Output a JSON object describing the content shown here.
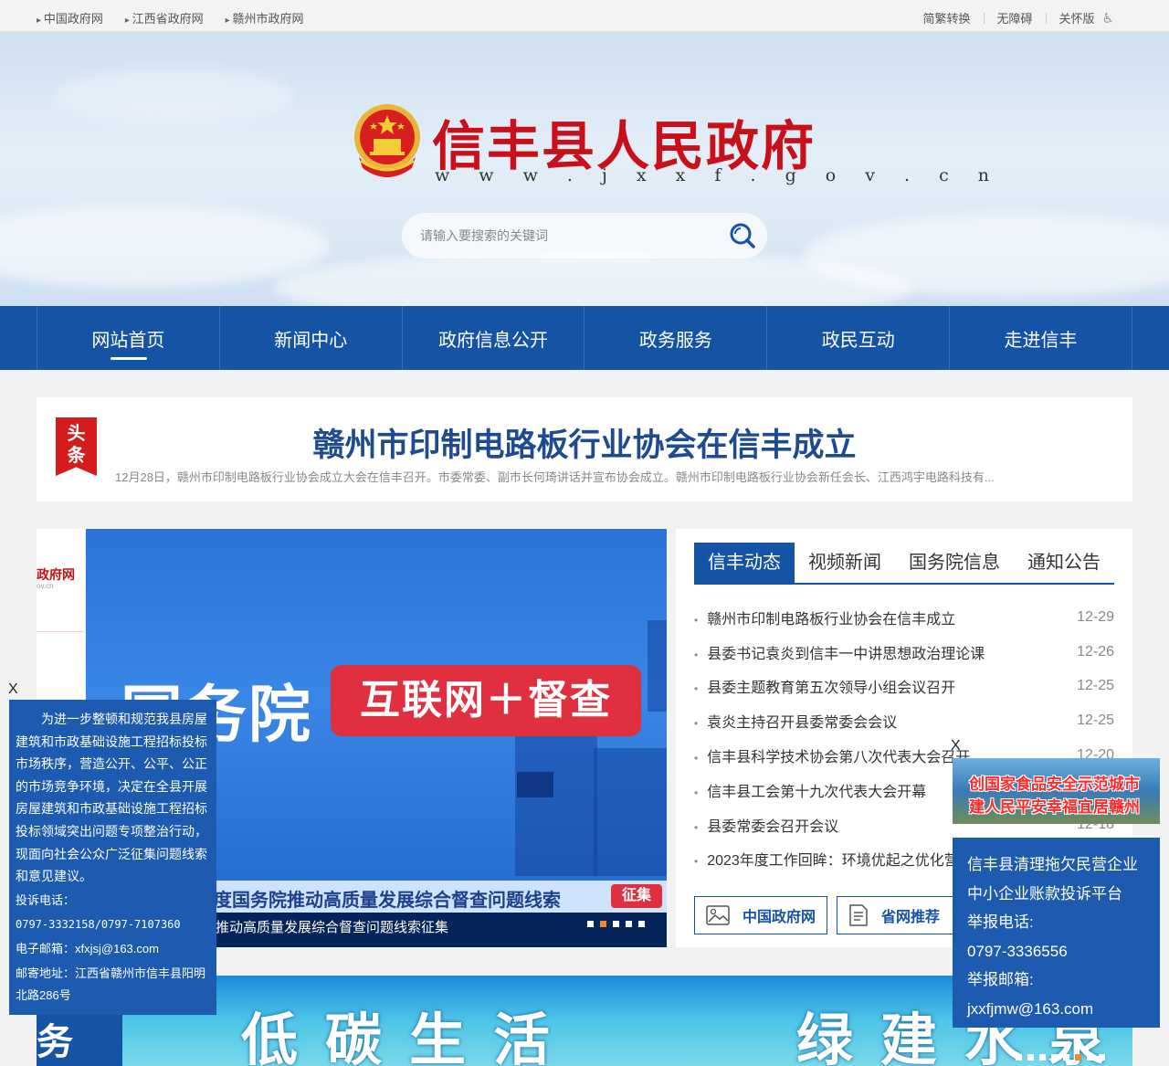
{
  "topbar": {
    "links": [
      "中国政府网",
      "江西省政府网",
      "赣州市政府网"
    ],
    "tools": [
      "简繁转换",
      "无障碍",
      "关怀版"
    ]
  },
  "header": {
    "title": "信丰县人民政府",
    "url": "w w w . j x x f . g o v . c n",
    "search_placeholder": "请输入要搜索的关键词"
  },
  "nav": {
    "items": [
      "网站首页",
      "新闻中心",
      "政府信息公开",
      "政务服务",
      "政民互动",
      "走进信丰"
    ]
  },
  "headline": {
    "badge": [
      "头",
      "条"
    ],
    "title": "赣州市印制电路板行业协会在信丰成立",
    "summary": "12月28日，赣州市印制电路板行业协会成立大会在信丰召开。市委常委、副市长何琦讲话并宣布协会成立。赣州市印制电路板行业协会新任会长、江西鸿宇电路科技有..."
  },
  "slideshow": {
    "side_text": "政府网",
    "side_sub": "ov.cn",
    "big_text": "国务院",
    "red_text": "互联网＋督查",
    "stripe_text": "度国务院推动高质量发展综合督查问题线索",
    "stripe_tag": "征集",
    "caption": "推动高质量发展综合督查问题线索征集",
    "active_dot": 1,
    "dot_count": 5
  },
  "news": {
    "tabs": [
      "信丰动态",
      "视频新闻",
      "国务院信息",
      "通知公告"
    ],
    "active_tab": 0,
    "items": [
      {
        "title": "赣州市印制电路板行业协会在信丰成立",
        "date": "12-29"
      },
      {
        "title": "县委书记袁炎到信丰一中讲思想政治理论课",
        "date": "12-26"
      },
      {
        "title": "县委主题教育第五次领导小组会议召开",
        "date": "12-25"
      },
      {
        "title": "袁炎主持召开县委常委会会议",
        "date": "12-25"
      },
      {
        "title": "信丰县科学技术协会第八次代表大会召开",
        "date": "12-20"
      },
      {
        "title": "信丰县工会第十九次代表大会开幕",
        "date": ""
      },
      {
        "title": "县委常委会召开会议",
        "date": "12-18"
      },
      {
        "title": "2023年度工作回眸：环境优起之优化营",
        "date": ""
      }
    ],
    "quick_links": [
      "中国政府网",
      "省网推荐"
    ]
  },
  "low_banner": {
    "left_char": "务",
    "text1": "低碳生活",
    "text2": "绿建水泉"
  },
  "float_left": {
    "close": "X",
    "paragraph": "为进一步整顿和规范我县房屋建筑和市政基础设施工程招标投标市场秩序，营造公开、公平、公正的市场竞争环境，决定在全县开展房屋建筑和市政基础设施工程招标投标领域突出问题专项整治行动，现面向社会公众广泛征集问题线索和意见建议。",
    "phone": "投诉电话：",
    "phone_value": "0797-3332158/0797-7107360",
    "email": "电子邮箱：xfxjsj@163.com",
    "address": "邮寄地址：江西省赣州市信丰县阳明北路286号"
  },
  "float_right": {
    "close": "X",
    "img_line1": "创国家食品安全示范城市",
    "img_line2": "建人民平安幸福宜居赣州",
    "line1": "信丰县清理拖欠民营企业",
    "line2": "中小企业账款投诉平台",
    "line3": "举报电话:",
    "line4": "0797-3336556",
    "line5": "举报邮箱:",
    "line6": "jxxfjmw@163.com"
  }
}
